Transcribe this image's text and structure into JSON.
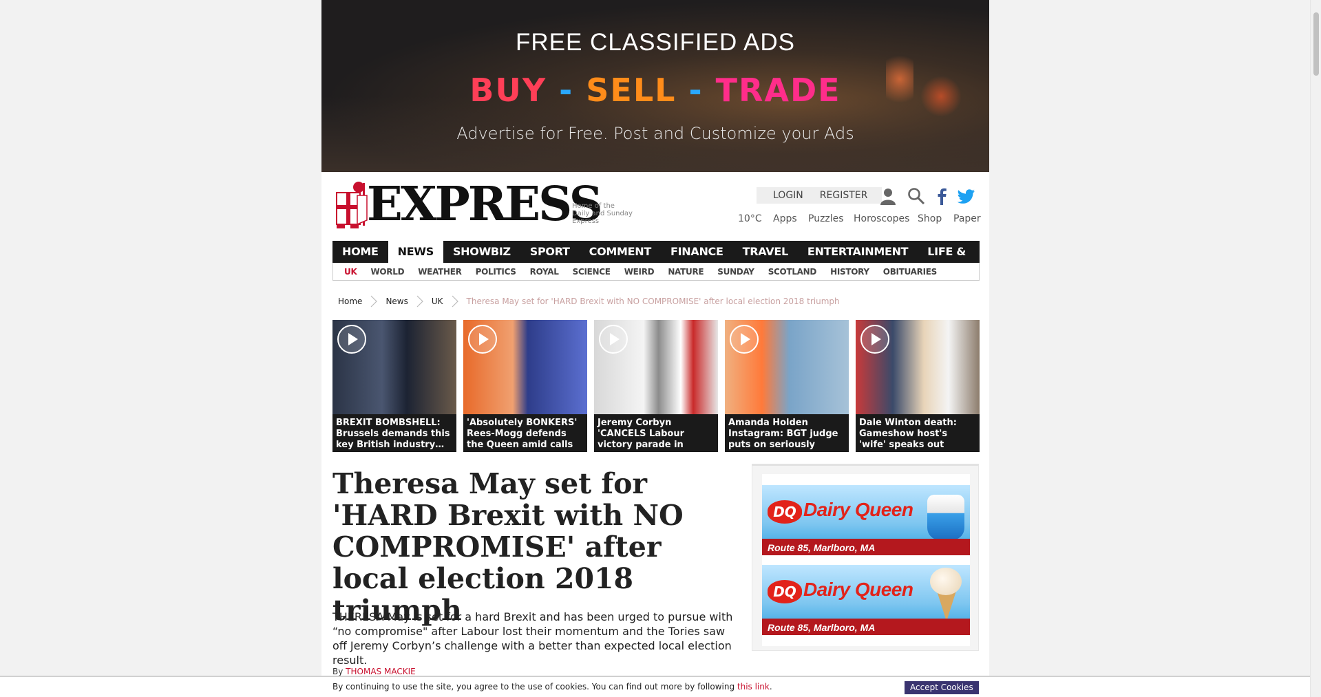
{
  "banner": {
    "title": "FREE CLASSIFIED ADS",
    "buy": "BUY",
    "sell": "SELL",
    "trade": "TRADE",
    "separator": "-",
    "subtitle": "Advertise for Free. Post and Customize your Ads"
  },
  "header": {
    "logo_text": "EXPRESS",
    "logo_tagline": "Home of the Daily and Sunday Express",
    "login": "LOGIN",
    "register": "REGISTER",
    "temperature": "10°C",
    "links": [
      "Apps",
      "Puzzles",
      "Horoscopes",
      "Shop",
      "Paper"
    ]
  },
  "nav": {
    "main": [
      "HOME",
      "NEWS",
      "SHOWBIZ & TV",
      "SPORT",
      "COMMENT",
      "FINANCE",
      "TRAVEL",
      "ENTERTAINMENT",
      "LIFE & STYLE"
    ],
    "active_main": "NEWS",
    "sub": [
      "UK",
      "WORLD",
      "WEATHER",
      "POLITICS",
      "ROYAL",
      "SCIENCE",
      "WEIRD",
      "NATURE",
      "SUNDAY",
      "SCOTLAND",
      "HISTORY",
      "OBITUARIES"
    ],
    "active_sub": "UK"
  },
  "breadcrumb": {
    "items": [
      "Home",
      "News",
      "UK"
    ],
    "current": "Theresa May set for 'HARD Brexit with NO COMPROMISE' after local election 2018 triumph"
  },
  "carousel": [
    {
      "caption": "BREXIT BOMBSHELL: Brussels demands this key British industry…"
    },
    {
      "caption": "'Absolutely BONKERS' Rees-Mogg defends the Queen amid calls"
    },
    {
      "caption": "Jeremy Corbyn 'CANCELS Labour victory parade in"
    },
    {
      "caption": "Amanda Holden Instagram: BGT judge puts on seriously"
    },
    {
      "caption": "Dale Winton death: Gameshow host's 'wife' speaks out"
    }
  ],
  "article": {
    "headline": "Theresa May set for 'HARD Brexit with NO COMPROMISE' after local election 2018 triumph",
    "standfirst": "THERESA May is set for a hard Brexit and has been urged to pursue with “no compromise\" after Labour lost their momentum and the Tories saw off Jeremy Corbyn’s challenge with a better than expected local election result.",
    "byline_prefix": "By",
    "author": "THOMAS MACKIE"
  },
  "sidead": {
    "brand": "Dairy Queen",
    "logo": "DQ",
    "location": "Route 85, Marlboro, MA"
  },
  "cookie": {
    "message": "By continuing to use the site, you agree to the use of cookies. You can find out more by following",
    "link": "this link",
    "end": ".",
    "button": "Accept Cookies"
  }
}
